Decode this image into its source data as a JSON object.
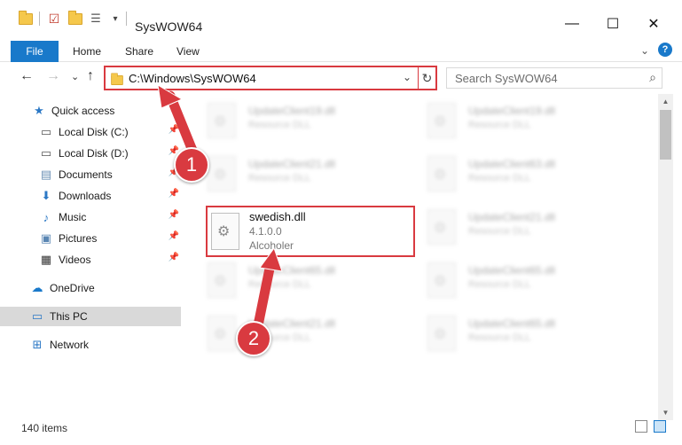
{
  "window": {
    "title": "SysWOW64",
    "minimize": "—",
    "maximize": "☐",
    "close": "✕"
  },
  "ribbon": {
    "tabs": [
      "File",
      "Home",
      "Share",
      "View"
    ],
    "chevron": "⌄",
    "help": "?"
  },
  "address": {
    "path": "C:\\Windows\\SysWOW64",
    "dropdown": "⌄",
    "refresh": "↻"
  },
  "search": {
    "placeholder": "Search SysWOW64",
    "icon": "search-icon"
  },
  "nav": {
    "back": "←",
    "forward": "→",
    "recent": "⌄",
    "up": "↑"
  },
  "sidebar": {
    "items": [
      {
        "label": "Quick access",
        "icon": "star-icon"
      },
      {
        "label": "Local Disk (C:)",
        "icon": "drive-icon"
      },
      {
        "label": "Local Disk (D:)",
        "icon": "drive-icon"
      },
      {
        "label": "Documents",
        "icon": "documents-icon"
      },
      {
        "label": "Downloads",
        "icon": "downloads-icon"
      },
      {
        "label": "Music",
        "icon": "music-icon"
      },
      {
        "label": "Pictures",
        "icon": "pictures-icon"
      },
      {
        "label": "Videos",
        "icon": "videos-icon"
      },
      {
        "label": "OneDrive",
        "icon": "cloud-icon"
      },
      {
        "label": "This PC",
        "icon": "computer-icon"
      },
      {
        "label": "Network",
        "icon": "network-icon"
      }
    ]
  },
  "files": {
    "background": [
      {
        "name": "UpdateClient19.dll",
        "type": "Resource DLL"
      },
      {
        "name": "UpdateClient19.dll",
        "type": "Resource DLL"
      },
      {
        "name": "UpdateClient21.dll",
        "type": "Resource DLL"
      },
      {
        "name": "UpdateClient63.dll",
        "type": "Resource DLL"
      },
      {
        "name": "UpdateClient21.dll",
        "type": "Resource DLL"
      },
      {
        "name": "UpdateClient65.dll",
        "type": "Resource DLL"
      },
      {
        "name": "UpdateClient65.dll",
        "type": "Resource DLL"
      },
      {
        "name": "UpdateClient21.dll",
        "type": "Resource DLL"
      },
      {
        "name": "UpdateClient65.dll",
        "type": "Resource DLL"
      }
    ],
    "highlighted": {
      "name": "swedish.dll",
      "version": "4.1.0.0",
      "company": "Alcoholer"
    }
  },
  "status": {
    "item_count": "140 items"
  },
  "steps": [
    "1",
    "2"
  ],
  "colors": {
    "accent": "#1979ca",
    "highlight": "#d93a40"
  }
}
